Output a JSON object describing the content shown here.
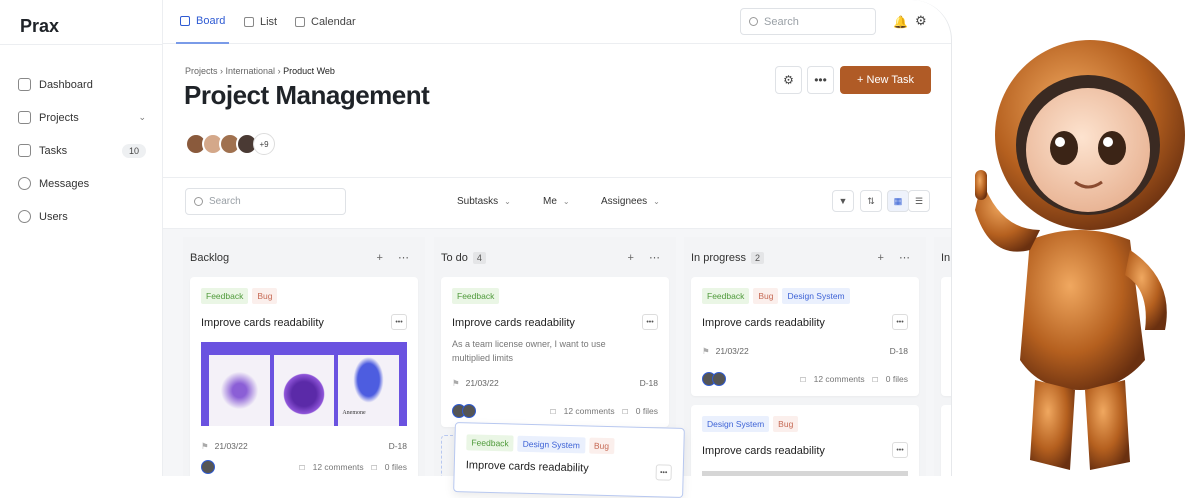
{
  "app": {
    "name": "Prax"
  },
  "sidebar": {
    "items": [
      {
        "label": "Dashboard"
      },
      {
        "label": "Projects"
      },
      {
        "label": "Tasks",
        "badge": "10"
      },
      {
        "label": "Messages"
      },
      {
        "label": "Users"
      }
    ]
  },
  "topnav": {
    "tabs": [
      {
        "label": "Board"
      },
      {
        "label": "List"
      },
      {
        "label": "Calendar"
      }
    ],
    "search_placeholder": "Search"
  },
  "header": {
    "breadcrumb": [
      "Projects",
      "International",
      "Product Web"
    ],
    "title": "Project Management",
    "new_task": "New Task",
    "more_members": "+9"
  },
  "toolbar": {
    "search_placeholder": "Search",
    "filters": [
      "Subtasks",
      "Me",
      "Assignees"
    ]
  },
  "columns": [
    {
      "title": "Backlog",
      "count": "",
      "cards": [
        {
          "tags": [
            "Feedback",
            "Bug"
          ],
          "title": "Improve cards readability",
          "image_caption": "Anemone",
          "date": "21/03/22",
          "id": "D-18",
          "comments": "12 comments",
          "files": "0 files"
        }
      ]
    },
    {
      "title": "To do",
      "count": "4",
      "cards": [
        {
          "tags": [
            "Feedback"
          ],
          "title": "Improve cards readability",
          "desc": "As a team license owner, I want to use multiplied limits",
          "date": "21/03/22",
          "id": "D-18",
          "comments": "12 comments",
          "files": "0 files"
        }
      ]
    },
    {
      "title": "In progress",
      "count": "2",
      "cards": [
        {
          "tags": [
            "Feedback",
            "Bug",
            "Design System"
          ],
          "title": "Improve cards readability",
          "date": "21/03/22",
          "id": "D-18",
          "comments": "12 comments",
          "files": "0 files"
        },
        {
          "tags": [
            "Design System",
            "Bug"
          ],
          "title": "Improve cards readability"
        }
      ]
    },
    {
      "title": "In",
      "count": ""
    }
  ],
  "dragging_card": {
    "tags": [
      "Feedback",
      "Design System",
      "Bug"
    ],
    "title": "Improve cards readability"
  },
  "colors": {
    "accent": "#2f5bd3",
    "brand": "#b05b26"
  }
}
